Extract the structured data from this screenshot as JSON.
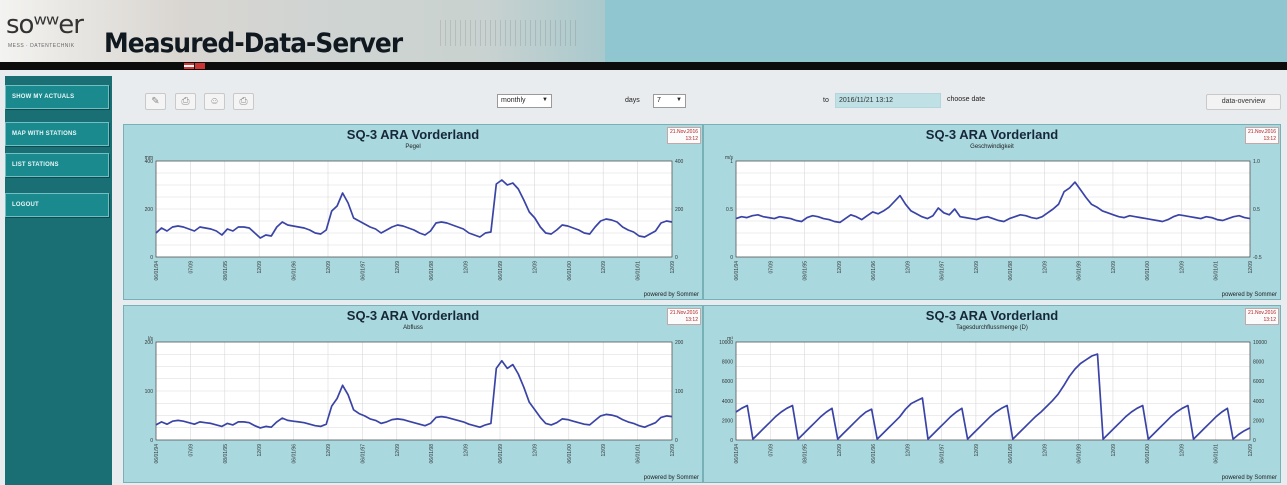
{
  "header": {
    "logo": "soʷʷer",
    "logo_sub": "MESS · DATENTECHNIK",
    "app_title": "Measured-Data-Server"
  },
  "sidebar": {
    "items": [
      {
        "label": "SHOW MY ACTUALS"
      },
      {
        "label": "MAP WITH STATIONS"
      },
      {
        "label": "LIST STATIONS"
      },
      {
        "label": "LOGOUT"
      }
    ]
  },
  "toolbar": {
    "period_value": "monthly",
    "span_label": "days",
    "span_value": "7",
    "to_label": "to",
    "date_value": "2016/11/21 13:12",
    "choose_date_label": "choose date",
    "data_overview_label": "data-overview"
  },
  "icons": [
    "pencil-icon",
    "print-icon",
    "person-icon",
    "printer-icon"
  ],
  "chart_data": [
    {
      "type": "line",
      "title": "SQ-3 ARA Vorderland",
      "subtitle": "Pegel",
      "ylabel_left": "mm",
      "datestamp": "21.Nov.2016 13:12",
      "yticks_left": [
        "0",
        "200",
        "400"
      ],
      "yticks_right": [
        "0",
        "200",
        "400"
      ],
      "x_ticks": [
        "06/01/94",
        "07/09",
        "08/01/95",
        "12/09",
        "06/01/96",
        "12/09",
        "06/01/97",
        "12/09",
        "06/01/98",
        "12/09",
        "06/01/99",
        "12/09",
        "06/01/00",
        "12/09",
        "06/01/01",
        "12/09"
      ],
      "ylim": [
        0,
        480
      ],
      "series": [
        {
          "values": [
            120,
            145,
            130,
            150,
            155,
            150,
            140,
            130,
            150,
            145,
            140,
            130,
            110,
            140,
            130,
            150,
            150,
            145,
            120,
            95,
            110,
            105,
            150,
            175,
            160,
            155,
            150,
            145,
            135,
            120,
            115,
            135,
            230,
            255,
            320,
            270,
            195,
            180,
            165,
            150,
            140,
            120,
            135,
            150,
            160,
            155,
            145,
            135,
            120,
            110,
            130,
            170,
            175,
            170,
            160,
            150,
            140,
            120,
            110,
            100,
            120,
            125,
            365,
            385,
            360,
            370,
            340,
            285,
            225,
            195,
            150,
            120,
            115,
            135,
            160,
            155,
            145,
            135,
            120,
            115,
            150,
            180,
            190,
            185,
            175,
            150,
            135,
            125,
            105,
            100,
            115,
            130,
            170,
            180,
            175
          ]
        }
      ],
      "powered": "powered by Sommer"
    },
    {
      "type": "line",
      "title": "SQ-3 ARA Vorderland",
      "subtitle": "Geschwindigkeit",
      "ylabel_left": "m/s",
      "datestamp": "21.Nov.2016 13:12",
      "yticks_left": [
        "0",
        "0.5",
        "1"
      ],
      "yticks_right": [
        "-0.5",
        "0.5",
        "1.0"
      ],
      "x_ticks": [
        "06/01/94",
        "07/09",
        "08/01/95",
        "12/09",
        "06/01/96",
        "12/09",
        "06/01/97",
        "12/09",
        "06/01/98",
        "12/09",
        "06/01/99",
        "12/09",
        "06/01/00",
        "12/09",
        "06/01/01",
        "12/09"
      ],
      "ylim": [
        0,
        1.0
      ],
      "series": [
        {
          "values": [
            0.4,
            0.42,
            0.41,
            0.43,
            0.44,
            0.42,
            0.41,
            0.4,
            0.42,
            0.41,
            0.4,
            0.38,
            0.37,
            0.41,
            0.43,
            0.42,
            0.4,
            0.39,
            0.37,
            0.36,
            0.4,
            0.44,
            0.42,
            0.39,
            0.43,
            0.47,
            0.45,
            0.48,
            0.52,
            0.58,
            0.64,
            0.55,
            0.48,
            0.45,
            0.42,
            0.4,
            0.43,
            0.51,
            0.46,
            0.44,
            0.5,
            0.42,
            0.41,
            0.4,
            0.39,
            0.41,
            0.42,
            0.4,
            0.38,
            0.37,
            0.4,
            0.42,
            0.44,
            0.43,
            0.41,
            0.4,
            0.42,
            0.46,
            0.5,
            0.55,
            0.68,
            0.72,
            0.78,
            0.7,
            0.62,
            0.55,
            0.52,
            0.48,
            0.46,
            0.44,
            0.42,
            0.41,
            0.43,
            0.42,
            0.41,
            0.4,
            0.39,
            0.38,
            0.37,
            0.39,
            0.42,
            0.44,
            0.43,
            0.42,
            0.41,
            0.4,
            0.42,
            0.41,
            0.39,
            0.38,
            0.4,
            0.42,
            0.43,
            0.41,
            0.4
          ]
        }
      ],
      "powered": "powered by Sommer"
    },
    {
      "type": "line",
      "title": "SQ-3 ARA Vorderland",
      "subtitle": "Abfluss",
      "ylabel_left": "l/s",
      "datestamp": "21.Nov.2016 13:12",
      "yticks_left": [
        "0",
        "100",
        "200"
      ],
      "yticks_right": [
        "0",
        "100",
        "200"
      ],
      "x_ticks": [
        "06/01/94",
        "07/09",
        "08/01/95",
        "12/09",
        "06/01/96",
        "12/09",
        "06/01/97",
        "12/09",
        "06/01/98",
        "12/09",
        "06/01/99",
        "12/09",
        "06/01/00",
        "12/09",
        "06/01/01",
        "12/09"
      ],
      "ylim": [
        0,
        260
      ],
      "series": [
        {
          "values": [
            40,
            48,
            42,
            50,
            52,
            50,
            46,
            42,
            48,
            46,
            44,
            40,
            36,
            44,
            40,
            48,
            48,
            46,
            38,
            32,
            36,
            34,
            48,
            58,
            52,
            50,
            48,
            46,
            42,
            38,
            36,
            42,
            90,
            110,
            145,
            120,
            80,
            70,
            64,
            56,
            52,
            44,
            48,
            54,
            56,
            54,
            50,
            46,
            42,
            38,
            44,
            60,
            62,
            60,
            56,
            52,
            48,
            42,
            38,
            34,
            40,
            44,
            190,
            210,
            190,
            200,
            175,
            140,
            100,
            80,
            60,
            44,
            40,
            46,
            56,
            54,
            50,
            46,
            42,
            40,
            52,
            64,
            68,
            66,
            62,
            54,
            48,
            44,
            38,
            34,
            40,
            46,
            60,
            64,
            62
          ]
        }
      ],
      "powered": "powered by Sommer"
    },
    {
      "type": "line",
      "title": "SQ-3 ARA Vorderland",
      "subtitle": "Tagesdurchflussmenge (D)",
      "ylabel_left": "m³",
      "datestamp": "21.Nov.2016 13:12",
      "yticks_left": [
        "0",
        "2000",
        "4000",
        "6000",
        "8000",
        "10000"
      ],
      "yticks_right": [
        "0",
        "2000",
        "4000",
        "6000",
        "8000",
        "10000"
      ],
      "x_ticks": [
        "06/01/94",
        "07/09",
        "08/01/95",
        "12/09",
        "06/01/96",
        "12/09",
        "06/01/97",
        "12/09",
        "06/01/98",
        "12/09",
        "06/01/99",
        "12/09",
        "06/01/00",
        "12/09",
        "06/01/01",
        "12/09"
      ],
      "ylim": [
        0,
        10500
      ],
      "series": [
        {
          "values": [
            3000,
            3400,
            3700,
            100,
            700,
            1300,
            1900,
            2500,
            3000,
            3400,
            3700,
            100,
            700,
            1300,
            1900,
            2500,
            3000,
            3400,
            100,
            700,
            1300,
            1900,
            2500,
            3000,
            3300,
            100,
            700,
            1300,
            1900,
            2500,
            3300,
            3900,
            4200,
            4500,
            100,
            700,
            1300,
            1900,
            2500,
            3000,
            3400,
            100,
            700,
            1300,
            1900,
            2500,
            3000,
            3400,
            3700,
            100,
            700,
            1300,
            1900,
            2500,
            3000,
            3600,
            4200,
            4900,
            5800,
            6800,
            7600,
            8200,
            8600,
            9000,
            9200,
            100,
            700,
            1300,
            1900,
            2500,
            3000,
            3400,
            3700,
            100,
            700,
            1300,
            1900,
            2500,
            3000,
            3400,
            3700,
            100,
            700,
            1300,
            1900,
            2500,
            3000,
            3400,
            100,
            600,
            1000,
            1300
          ]
        }
      ],
      "powered": "powered by Sommer"
    }
  ]
}
